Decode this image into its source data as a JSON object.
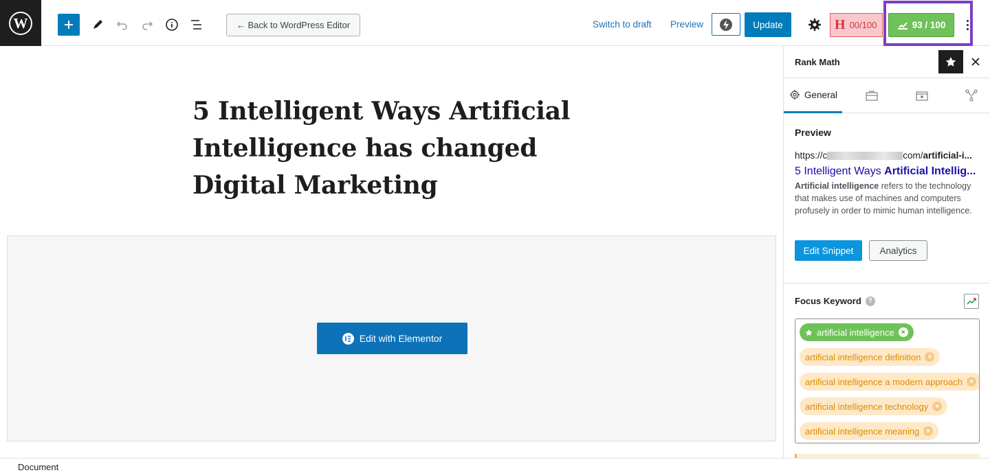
{
  "toolbar": {
    "back_label": "← Back to WordPress Editor",
    "switch_draft": "Switch to draft",
    "preview": "Preview",
    "update": "Update",
    "headline_score": "00/100",
    "headline_logo": "H",
    "rankmath_score": "93 / 100",
    "icons": [
      "wordpress-logo",
      "plus-icon",
      "pencil-icon",
      "undo-icon",
      "redo-icon",
      "info-icon",
      "list-view-icon",
      "bolt-icon",
      "gear-icon",
      "more-icon"
    ]
  },
  "editor": {
    "post_title": "5 Intelligent Ways Artificial Intelligence has changed Digital Marketing",
    "elementor_button": "Edit with Elementor"
  },
  "footer": {
    "breadcrumb": "Document"
  },
  "sidebar": {
    "title": "Rank Math",
    "tabs": [
      {
        "label": "General"
      }
    ],
    "preview": {
      "heading": "Preview",
      "url_prefix": "https://c",
      "url_suffix": "com/",
      "url_slug": "artificial-i...",
      "title_plain": "5 Intelligent Ways ",
      "title_bold": "Artificial Intellig...",
      "desc_bold": "Artificial intelligence",
      "desc_rest": " refers to the technology that makes use of machines and computers profusely in order to mimic human intelligence.",
      "edit_snippet": "Edit Snippet",
      "analytics": "Analytics"
    },
    "focus_keyword": {
      "label": "Focus Keyword",
      "help": "?",
      "keywords": [
        {
          "text": "artificial intelligence",
          "primary": true
        },
        {
          "text": "artificial intelligence definition",
          "primary": false
        },
        {
          "text": "artificial intelligence a modern approach",
          "primary": false
        },
        {
          "text": "artificial intelligence technology",
          "primary": false
        },
        {
          "text": "artificial intelligence meaning",
          "primary": false
        }
      ]
    }
  },
  "colors": {
    "wp_blue": "#007cba",
    "rankmath_green": "#6fc259",
    "highlight_purple": "#7b3fc4",
    "headline_red": "#d63638",
    "keyword_orange": "#e08a00"
  }
}
